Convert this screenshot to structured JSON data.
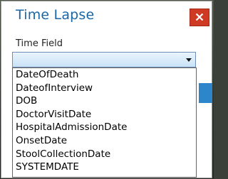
{
  "dialog": {
    "title": "Time Lapse",
    "field_label": "Time Field",
    "selected_value": "",
    "options": [
      "DateOfDeath",
      "DateofInterview",
      "DOB",
      "DoctorVisitDate",
      "HospitalAdmissionDate",
      "OnsetDate",
      "StoolCollectionDate",
      "SYSTEMDATE"
    ]
  },
  "icons": {
    "close": "close-icon",
    "dropdown_arrow": "chevron-down-icon"
  },
  "colors": {
    "title": "#1a67a8",
    "close_button": "#cf3a24",
    "combo_fill": "#c9e2f7",
    "accent_button": "#2d86c9"
  }
}
